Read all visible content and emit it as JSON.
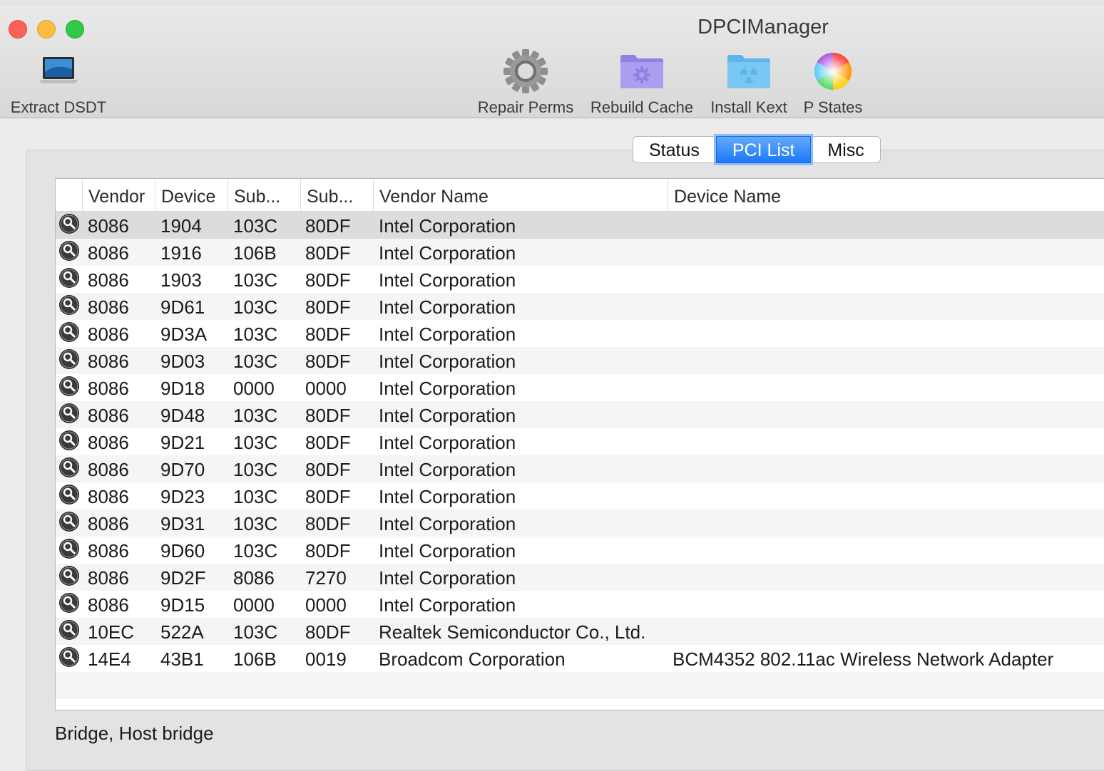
{
  "window": {
    "title": "DPCIManager"
  },
  "toolbar": {
    "extract": {
      "label": "Extract DSDT",
      "icon": "laptop-icon"
    },
    "repair": {
      "label": "Repair Perms",
      "icon": "gear-icon"
    },
    "rebuild": {
      "label": "Rebuild Cache",
      "icon": "settings-folder-icon"
    },
    "install": {
      "label": "Install Kext",
      "icon": "kext-folder-icon"
    },
    "pstates": {
      "label": "P States",
      "icon": "color-wheel-icon"
    }
  },
  "tabs": [
    {
      "label": "Status",
      "active": false
    },
    {
      "label": "PCI List",
      "active": true
    },
    {
      "label": "Misc",
      "active": false
    }
  ],
  "table": {
    "columns": [
      "Vendor",
      "Device",
      "Sub...",
      "Sub...",
      "Vendor Name",
      "Device Name"
    ],
    "rows": [
      [
        "8086",
        "1904",
        "103C",
        "80DF",
        "Intel Corporation",
        ""
      ],
      [
        "8086",
        "1916",
        "106B",
        "80DF",
        "Intel Corporation",
        ""
      ],
      [
        "8086",
        "1903",
        "103C",
        "80DF",
        "Intel Corporation",
        ""
      ],
      [
        "8086",
        "9D61",
        "103C",
        "80DF",
        "Intel Corporation",
        ""
      ],
      [
        "8086",
        "9D3A",
        "103C",
        "80DF",
        "Intel Corporation",
        ""
      ],
      [
        "8086",
        "9D03",
        "103C",
        "80DF",
        "Intel Corporation",
        ""
      ],
      [
        "8086",
        "9D18",
        "0000",
        "0000",
        "Intel Corporation",
        ""
      ],
      [
        "8086",
        "9D48",
        "103C",
        "80DF",
        "Intel Corporation",
        ""
      ],
      [
        "8086",
        "9D21",
        "103C",
        "80DF",
        "Intel Corporation",
        ""
      ],
      [
        "8086",
        "9D70",
        "103C",
        "80DF",
        "Intel Corporation",
        ""
      ],
      [
        "8086",
        "9D23",
        "103C",
        "80DF",
        "Intel Corporation",
        ""
      ],
      [
        "8086",
        "9D31",
        "103C",
        "80DF",
        "Intel Corporation",
        ""
      ],
      [
        "8086",
        "9D60",
        "103C",
        "80DF",
        "Intel Corporation",
        ""
      ],
      [
        "8086",
        "9D2F",
        "8086",
        "7270",
        "Intel Corporation",
        ""
      ],
      [
        "8086",
        "9D15",
        "0000",
        "0000",
        "Intel Corporation",
        ""
      ],
      [
        "10EC",
        "522A",
        "103C",
        "80DF",
        "Realtek Semiconductor Co., Ltd.",
        ""
      ],
      [
        "14E4",
        "43B1",
        "106B",
        "0019",
        "Broadcom Corporation",
        "BCM4352 802.11ac Wireless Network Adapter"
      ]
    ],
    "selected_row": 0,
    "row_icon": "magnifier-icon"
  },
  "status": {
    "text": "Bridge, Host bridge"
  },
  "colors": {
    "accent": "#1c78f5",
    "close": "#fc605b",
    "minimize": "#fdbc40",
    "maximize": "#34c84a"
  }
}
